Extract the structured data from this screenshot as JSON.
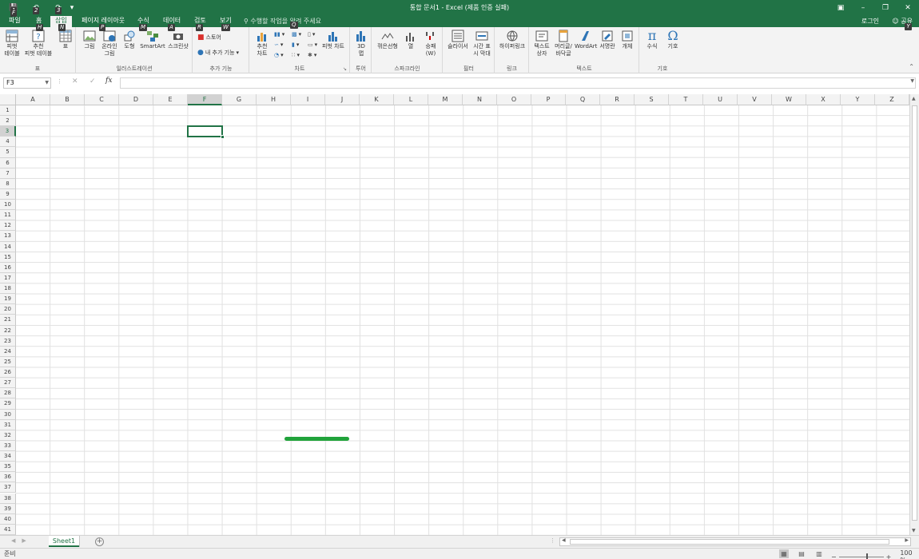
{
  "app": {
    "title": "통합 문서1 - Excel (제품 인증 실패)"
  },
  "quick_access": {
    "save_keytip": "1",
    "undo_keytip": "2",
    "redo_keytip": "3"
  },
  "tabs": [
    {
      "label": "파일",
      "keytip": "F"
    },
    {
      "label": "홈",
      "keytip": "H"
    },
    {
      "label": "삽입",
      "keytip": "N",
      "active": true
    },
    {
      "label": "페이지 레이아웃",
      "keytip": "P"
    },
    {
      "label": "수식",
      "keytip": "M"
    },
    {
      "label": "데이터",
      "keytip": "A"
    },
    {
      "label": "검토",
      "keytip": "R"
    },
    {
      "label": "보기",
      "keytip": "W"
    }
  ],
  "tell_me": "수행할 작업을 알려 주세요",
  "tell_me_keytip": "Q",
  "account": {
    "login": "로그인",
    "share": "공유",
    "share_keytip": "Y"
  },
  "ribbon": {
    "groups": {
      "tables": "표",
      "illustrations": "일러스트레이션",
      "addins": "추가 기능",
      "charts": "차트",
      "tours": "투어",
      "sparklines": "스파크라인",
      "filters": "필터",
      "links": "링크",
      "text": "텍스트",
      "symbols": "기호"
    },
    "buttons": {
      "pivot_table": "피벗\n테이블",
      "recommended_pivot": "추천\n피벗 테이블",
      "table": "표",
      "picture": "그림",
      "online_picture": "온라인\n그림",
      "shapes": "도형",
      "smartart": "SmartArt",
      "screenshot": "스크린샷",
      "store": "스토어",
      "my_addins": "내 추가 기능",
      "recommended_charts": "추천\n차트",
      "pivot_chart": "피벗 차트",
      "map_3d": "3D\n맵",
      "line_spark": "꺾은선형",
      "column_spark": "열",
      "winloss_spark": "승패\n(W)",
      "slicer": "슬라이서",
      "timeline": "시간 표\n시 막대",
      "hyperlink": "하이퍼링크",
      "textbox": "텍스트\n상자",
      "header_footer": "머리글/\n바닥글",
      "wordart": "WordArt",
      "signature": "서명란",
      "object": "개체",
      "equation": "수식",
      "symbol": "기호"
    }
  },
  "formula_bar": {
    "name_box": "F3",
    "fx": "fx",
    "value": ""
  },
  "columns": [
    "A",
    "B",
    "C",
    "D",
    "E",
    "F",
    "G",
    "H",
    "I",
    "J",
    "K",
    "L",
    "M",
    "N",
    "O",
    "P",
    "Q",
    "R",
    "S",
    "T",
    "U",
    "V",
    "W",
    "X",
    "Y",
    "Z"
  ],
  "rows": [
    "1",
    "2",
    "3",
    "4",
    "5",
    "6",
    "7",
    "8",
    "9",
    "10",
    "11",
    "12",
    "13",
    "14",
    "15",
    "16",
    "17",
    "18",
    "19",
    "20",
    "21",
    "22",
    "23",
    "24",
    "25",
    "26",
    "27",
    "28",
    "29",
    "30",
    "31",
    "32",
    "33",
    "34",
    "35",
    "36",
    "37",
    "38",
    "39",
    "40",
    "41"
  ],
  "selection": {
    "col": "F",
    "row": "3"
  },
  "sheets": [
    "Sheet1"
  ],
  "status": {
    "ready": "준비",
    "zoom": "100 %"
  },
  "colors": {
    "accent": "#217346",
    "loading_bar": "#21a33b"
  }
}
